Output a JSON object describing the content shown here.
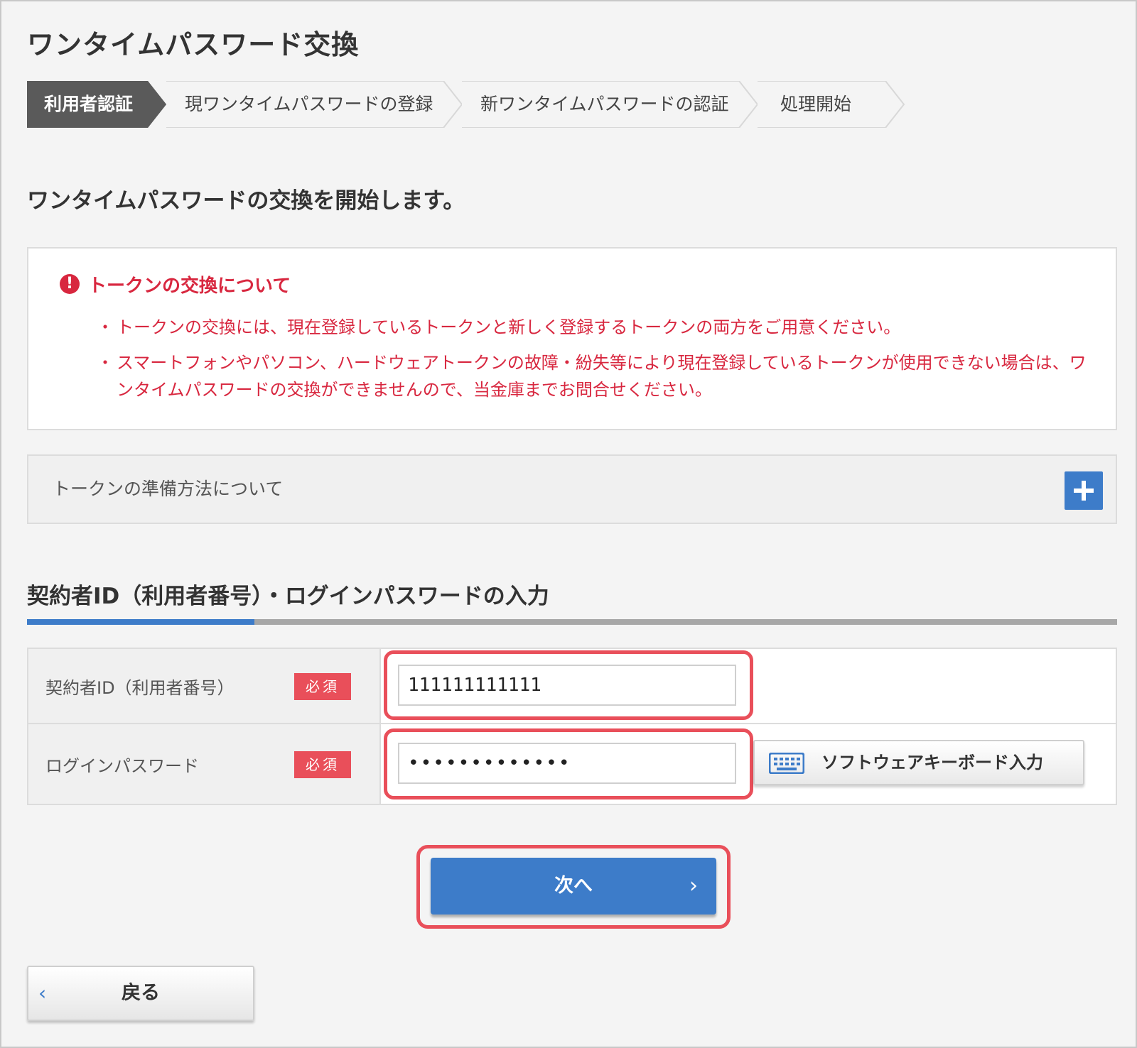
{
  "page": {
    "title": "ワンタイムパスワード交換"
  },
  "steps": [
    {
      "label": "利用者認証",
      "active": true
    },
    {
      "label": "現ワンタイムパスワードの登録",
      "active": false
    },
    {
      "label": "新ワンタイムパスワードの認証",
      "active": false
    },
    {
      "label": "処理開始",
      "active": false
    }
  ],
  "lead": "ワンタイムパスワードの交換を開始します。",
  "notice": {
    "title": "トークンの交換について",
    "bullet": "・",
    "items": [
      "トークンの交換には、現在登録しているトークンと新しく登録するトークンの両方をご用意ください。",
      "スマートフォンやパソコン、ハードウェアトークンの故障・紛失等により現在登録しているトークンが使用できない場合は、ワンタイムパスワードの交換ができませんので、当金庫までお問合せください。"
    ]
  },
  "accordion": {
    "label": "トークンの準備方法について"
  },
  "section": {
    "title": "契約者ID（利用者番号）・ログインパスワードの入力"
  },
  "form": {
    "contract_id": {
      "label": "契約者ID（利用者番号）",
      "badge": "必須",
      "value": "111111111111"
    },
    "password": {
      "label": "ログインパスワード",
      "badge": "必須",
      "value": "•••••••••••••"
    },
    "keyboard_button": "ソフトウェアキーボード入力"
  },
  "buttons": {
    "next": "次へ",
    "next_chevron": "›",
    "back": "戻る",
    "back_chevron": "‹"
  },
  "colors": {
    "accent": "#3d7cc9",
    "alert": "#d8273f",
    "highlight": "#e94f5a",
    "active_step": "#5a5a5a"
  }
}
